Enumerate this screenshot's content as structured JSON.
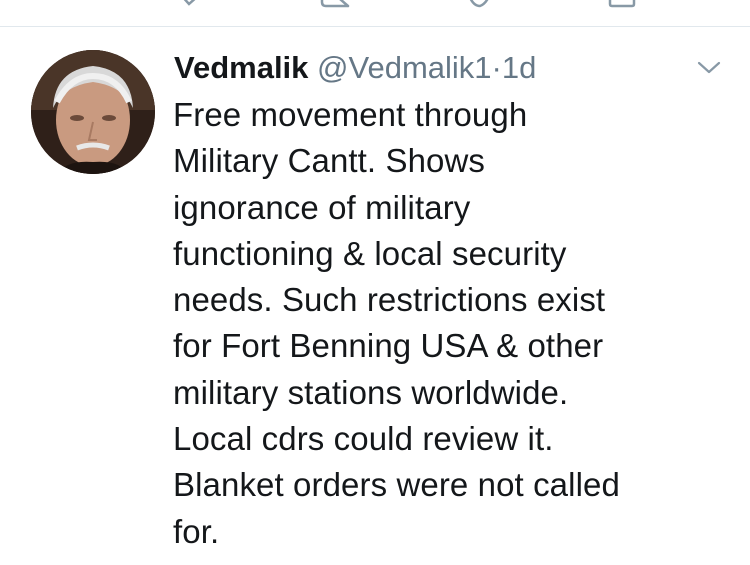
{
  "tweet": {
    "display_name": "Vedmalik",
    "handle": "@Vedmalik1",
    "separator": "·",
    "timestamp": "1d",
    "text": "Free movement through\nMilitary Cantt. Shows\nignorance of military\nfunctioning & local security\nneeds. Such restrictions exist\nfor Fort Benning USA & other\nmilitary stations worldwide.\nLocal cdrs could review it.\nBlanket orders were not called\nfor."
  },
  "icons": {
    "reply": "reply-icon",
    "retweet": "retweet-icon",
    "like": "like-icon",
    "share": "share-icon",
    "more": "chevron-down-icon",
    "avatar": "avatar"
  },
  "colors": {
    "text_primary": "#14171a",
    "text_secondary": "#657786",
    "divider": "#e1e8ed",
    "icon_gray": "#8899a6"
  }
}
